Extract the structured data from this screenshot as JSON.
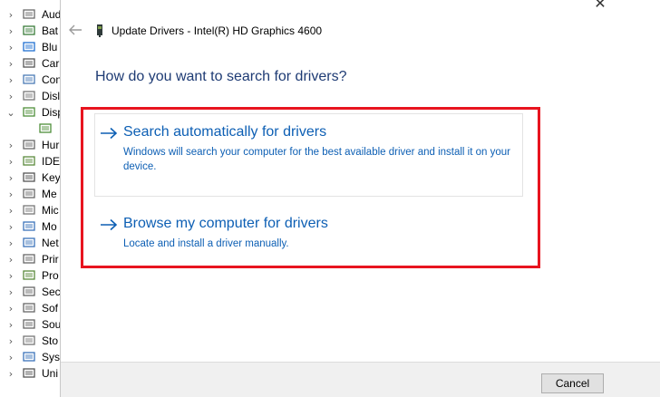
{
  "tree": {
    "items": [
      {
        "label": "Aud",
        "chevron": "›",
        "icon": "speaker-icon"
      },
      {
        "label": "Bat",
        "chevron": "›",
        "icon": "battery-icon"
      },
      {
        "label": "Blu",
        "chevron": "›",
        "icon": "bluetooth-icon"
      },
      {
        "label": "Car",
        "chevron": "›",
        "icon": "camera-icon"
      },
      {
        "label": "Con",
        "chevron": "›",
        "icon": "computer-icon"
      },
      {
        "label": "Disl",
        "chevron": "›",
        "icon": "disk-drive-icon"
      },
      {
        "label": "Disp",
        "chevron": "⌄",
        "icon": "display-adapter-icon"
      },
      {
        "label": "",
        "chevron": "",
        "icon": "display-adapter-child-icon"
      },
      {
        "label": "Hur",
        "chevron": "›",
        "icon": "hid-icon"
      },
      {
        "label": "IDE",
        "chevron": "›",
        "icon": "ide-controller-icon"
      },
      {
        "label": "Key",
        "chevron": "›",
        "icon": "keyboard-icon"
      },
      {
        "label": "Me",
        "chevron": "›",
        "icon": "memory-icon"
      },
      {
        "label": "Mic",
        "chevron": "›",
        "icon": "mouse-icon"
      },
      {
        "label": "Mo",
        "chevron": "›",
        "icon": "monitor-icon"
      },
      {
        "label": "Net",
        "chevron": "›",
        "icon": "network-adapter-icon"
      },
      {
        "label": "Prir",
        "chevron": "›",
        "icon": "print-queue-icon"
      },
      {
        "label": "Pro",
        "chevron": "›",
        "icon": "processor-icon"
      },
      {
        "label": "Sec",
        "chevron": "›",
        "icon": "security-device-icon"
      },
      {
        "label": "Sof",
        "chevron": "›",
        "icon": "software-component-icon"
      },
      {
        "label": "Sou",
        "chevron": "›",
        "icon": "sound-icon"
      },
      {
        "label": "Sto",
        "chevron": "›",
        "icon": "storage-controller-icon"
      },
      {
        "label": "Sys",
        "chevron": "›",
        "icon": "system-device-icon"
      },
      {
        "label": "Uni",
        "chevron": "›",
        "icon": "usb-icon"
      }
    ]
  },
  "dialog": {
    "title": "Update Drivers - Intel(R) HD Graphics 4600",
    "close_glyph": "✕",
    "heading": "How do you want to search for drivers?",
    "options": [
      {
        "title": "Search automatically for drivers",
        "description": "Windows will search your computer for the best available driver and install it on your device."
      },
      {
        "title": "Browse my computer for drivers",
        "description": "Locate and install a driver manually."
      }
    ],
    "cancel_label": "Cancel"
  },
  "colors": {
    "link_blue": "#0d5fb4",
    "heading_blue": "#1e3b74",
    "highlight_red": "#e8141f"
  }
}
